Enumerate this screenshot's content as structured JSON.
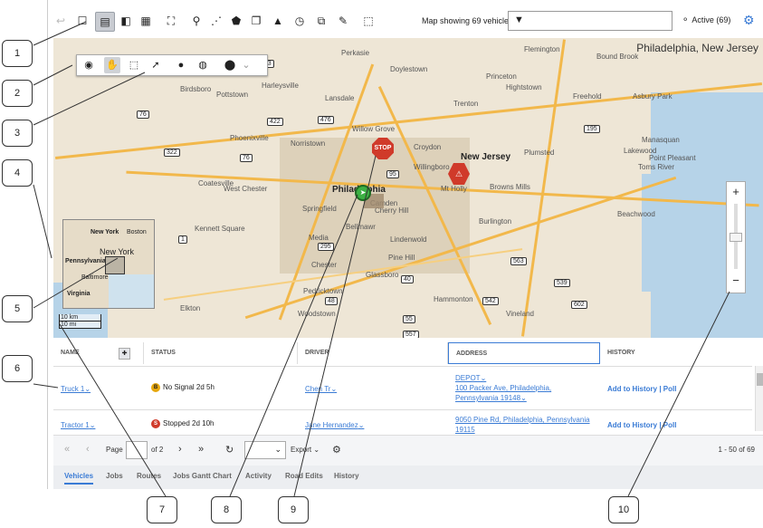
{
  "toolbar": {
    "map_status": "Map showing 69 vehicles",
    "active_label": "Active (69)"
  },
  "map": {
    "region_title": "Philadelphia, New Jersey",
    "places": [
      "Perkasie",
      "Doylestown",
      "Birdsboro",
      "Pottstown",
      "Harleysville",
      "Lansdale",
      "Phoenixville",
      "Norristown",
      "Coatesville",
      "West Chester",
      "Kennett Square",
      "Media",
      "Chester",
      "Elkton",
      "Philadelphia",
      "Camden",
      "Cherry Hill",
      "Springfield",
      "Bellmawr",
      "Lindenwold",
      "Pine Hill",
      "Glassboro",
      "Hammonton",
      "Willow Grove",
      "Croydon",
      "Willingboro",
      "Mt Holly",
      "Browns Mills",
      "Burlington",
      "Trenton",
      "Princeton",
      "Hightstown",
      "Freehold",
      "Asbury Park",
      "Toms River",
      "Lakewood",
      "Manasquan",
      "Point Pleasant",
      "Beachwood",
      "Plumsted",
      "New Jersey",
      "Pedricktown",
      "Woodstown",
      "Vineland",
      "Flemington",
      "Bound Brook"
    ],
    "shields": [
      "663",
      "422",
      "476",
      "76",
      "322",
      "76",
      "95",
      "295",
      "195",
      "1",
      "563",
      "539",
      "602",
      "542",
      "48",
      "40",
      "55",
      "557"
    ],
    "stop_label": "STOP",
    "overview": {
      "labels": [
        "New York",
        "New York",
        "Pennsylvania",
        "Baltimore",
        "Virginia",
        "Boston"
      ]
    },
    "scale": [
      "10 km",
      "10 mi"
    ]
  },
  "grid": {
    "headers": [
      "NAME",
      "STATUS",
      "DRIVER",
      "ADDRESS",
      "HISTORY"
    ],
    "rows": [
      {
        "name": "Truck 1",
        "status_icon": "B",
        "status_color": "#e8a80c",
        "status": "No Signal 2d 5h",
        "driver": "Chen Tr",
        "addr1": "DEPOT",
        "addr2": "100 Packer Ave, Philadelphia,",
        "addr3": "Pennsylvania 19148",
        "history": "Add to History | Poll"
      },
      {
        "name": "Tractor 1",
        "status_icon": "S",
        "status_color": "#d03a2a",
        "status": "Stopped 2d 10h",
        "driver": "Jane Hernandez",
        "addr1": "9050 Pine Rd, Philadelphia, Pennsylvania",
        "addr2": "19115",
        "addr3": "",
        "history": "Add to History | Poll"
      }
    ]
  },
  "pager": {
    "page_label": "Page",
    "of_label": "of 2",
    "export_label": "Export",
    "range": "1 - 50 of 69"
  },
  "tabs": [
    "Vehicles",
    "Jobs",
    "Routes",
    "Jobs Gantt Chart",
    "Activity",
    "Road Edits",
    "History"
  ],
  "callouts": [
    "1",
    "2",
    "3",
    "4",
    "5",
    "6",
    "7",
    "8",
    "9",
    "10"
  ]
}
